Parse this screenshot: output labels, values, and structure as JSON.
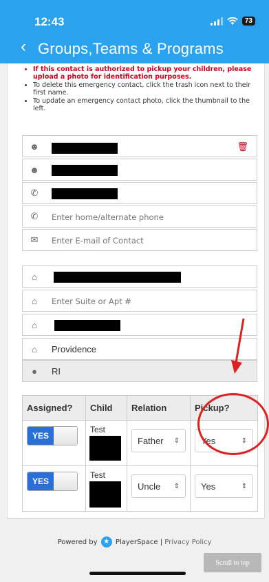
{
  "status_bar": {
    "time": "12:43",
    "battery": "73"
  },
  "nav": {
    "back_icon": "chevron-left-icon",
    "title": "Groups,Teams & Programs"
  },
  "notes": {
    "items": [
      {
        "text": "If this contact is authorized to pickup your children, please upload a photo for identification purposes.",
        "highlight": true
      },
      {
        "text": "To delete this emergency contact, click the trash icon next to their first name.",
        "highlight": false
      },
      {
        "text": "To update an emergency contact photo, click the thumbnail to the left.",
        "highlight": false
      }
    ]
  },
  "contact": {
    "home_phone_placeholder": "Enter home/alternate phone",
    "email_placeholder": "Enter E-mail of Contact"
  },
  "address": {
    "suite_placeholder": "Enter Suite or Apt #",
    "city": "Providence",
    "state": "RI"
  },
  "assignments": {
    "headers": [
      "Assigned?",
      "Child",
      "Relation",
      "Pickup?"
    ],
    "rows": [
      {
        "assigned": "YES",
        "child": "Test",
        "relation": "Father",
        "pickup": "Yes"
      },
      {
        "assigned": "YES",
        "child": "Test",
        "relation": "Uncle",
        "pickup": "Yes"
      }
    ]
  },
  "footer": {
    "powered_by": "Powered by",
    "brand": "PlayerSpace",
    "separator": "|",
    "privacy": "Privacy Policy",
    "scroll_top": "Scroll to top"
  },
  "colors": {
    "header_blue": "#2aa2ee",
    "toggle_blue": "#2a6fd6",
    "alert_red": "#d0021b",
    "annotation_red": "#e02020"
  }
}
